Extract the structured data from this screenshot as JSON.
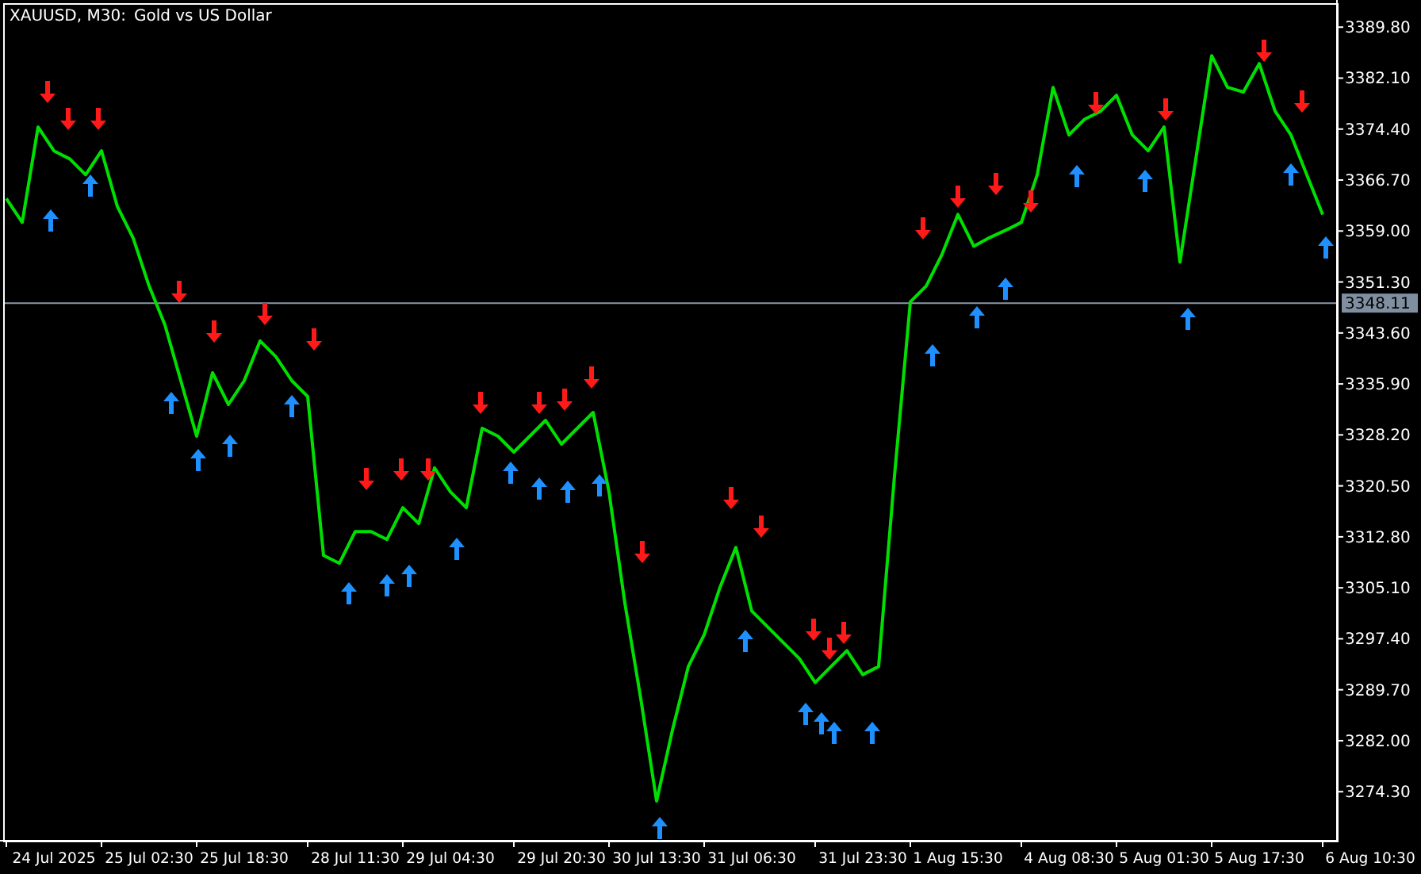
{
  "chart_title": {
    "symbol": "XAUUSD, M30:",
    "description": "Gold vs US Dollar"
  },
  "chart_data": {
    "type": "line",
    "ylim": [
      3266.9,
      3393.9
    ],
    "categories": [
      null,
      null,
      null,
      "24 Jul 2025",
      null,
      null,
      null,
      null,
      null,
      "25 Jul 02:30",
      null,
      null,
      null,
      null,
      null,
      "25 Jul 18:30",
      null,
      null,
      null,
      null,
      null,
      null,
      "28 Jul 11:30",
      null,
      null,
      null,
      null,
      null,
      "29 Jul 04:30",
      null,
      null,
      null,
      null,
      null,
      null,
      "29 Jul 20:30",
      null,
      null,
      null,
      null,
      null,
      "30 Jul 13:30",
      null,
      null,
      null,
      null,
      null,
      "31 Jul 06:30",
      null,
      null,
      null,
      null,
      null,
      null,
      "31 Jul 23:30",
      null,
      null,
      null,
      null,
      null,
      "1 Aug 15:30",
      null,
      null,
      null,
      null,
      null,
      null,
      "4 Aug 08:30",
      null,
      null,
      null,
      null,
      null,
      "5 Aug 01:30",
      null,
      null,
      null,
      null,
      null,
      "5 Aug 17:30",
      null,
      null,
      null,
      null,
      null,
      null,
      "6 Aug 10:30"
    ],
    "yticks": [
      {
        "value": 3389.8,
        "label": "3389.80"
      },
      {
        "value": 3382.1,
        "label": "3382.10"
      },
      {
        "value": 3374.4,
        "label": "3374.40"
      },
      {
        "value": 3366.7,
        "label": "3366.70"
      },
      {
        "value": 3359.0,
        "label": "3359.00"
      },
      {
        "value": 3351.3,
        "label": "3351.30"
      },
      {
        "value": 3343.6,
        "label": "3343.60"
      },
      {
        "value": 3335.9,
        "label": "3335.90"
      },
      {
        "value": 3328.2,
        "label": "3328.20"
      },
      {
        "value": 3320.5,
        "label": "3320.50"
      },
      {
        "value": 3312.8,
        "label": "3312.80"
      },
      {
        "value": 3305.1,
        "label": "3305.10"
      },
      {
        "value": 3297.4,
        "label": "3297.40"
      },
      {
        "value": 3289.7,
        "label": "3289.70"
      },
      {
        "value": 3282.0,
        "label": "3282.00"
      },
      {
        "value": 3274.3,
        "label": "3274.30"
      }
    ],
    "series": [
      {
        "color": "#00e000",
        "values": [
          3363.9,
          3360.3,
          3374.7,
          3371.1,
          3369.9,
          3367.5,
          3371.1,
          3362.7,
          3357.9,
          3350.7,
          3344.8,
          3336.4,
          3328.0,
          3337.6,
          3332.8,
          3336.4,
          3342.4,
          3340.0,
          3336.4,
          3334.0,
          3310.0,
          3308.8,
          3313.6,
          3313.6,
          3312.4,
          3317.2,
          3314.8,
          3323.2,
          3319.6,
          3317.2,
          3329.2,
          3328.0,
          3325.6,
          3328.0,
          3330.4,
          3326.8,
          3329.2,
          3331.6,
          3319.6,
          3302.8,
          3288.4,
          3272.9,
          3283.6,
          3293.2,
          3298.0,
          3305.2,
          3311.2,
          3301.6,
          3299.2,
          3296.8,
          3294.4,
          3290.8,
          3293.2,
          3295.6,
          3292.0,
          3293.2,
          3322.0,
          3348.3,
          3350.7,
          3355.5,
          3361.5,
          3356.7,
          3358.0,
          3359.1,
          3360.3,
          3367.5,
          3380.7,
          3373.5,
          3375.9,
          3377.1,
          3379.5,
          3373.5,
          3371.1,
          3374.7,
          3354.3,
          3369.9,
          3385.5,
          3380.7,
          3380.0,
          3384.3,
          3377.1,
          3373.5,
          3367.5,
          3361.5,
          null,
          null,
          null
        ]
      }
    ],
    "ref_lines": [
      {
        "axis": "y",
        "value": 3348.11,
        "label": "3348.11"
      }
    ]
  }
}
